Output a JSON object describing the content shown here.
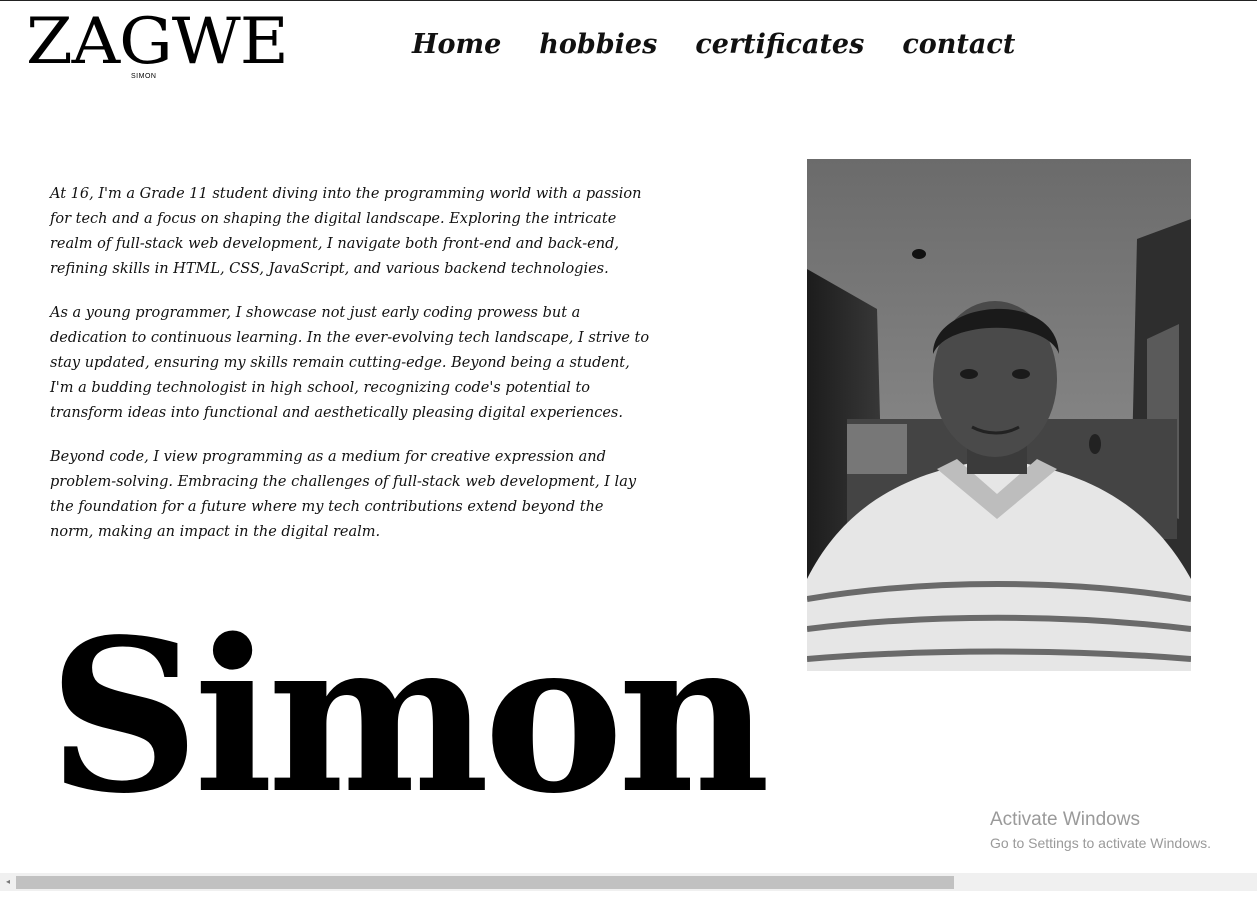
{
  "logo": {
    "text": "ZAGWE",
    "subtext": "SIMON"
  },
  "nav": {
    "items": [
      {
        "label": "Home"
      },
      {
        "label": "hobbies"
      },
      {
        "label": "certificates"
      },
      {
        "label": "contact"
      }
    ]
  },
  "bio": {
    "paragraphs": [
      "At 16, I'm a Grade 11 student diving into the programming world with a passion for tech and a focus on shaping the digital landscape. Exploring the intricate realm of full-stack web development, I navigate both front-end and back-end, refining skills in HTML, CSS, JavaScript, and various backend technologies.",
      "As a young programmer, I showcase not just early coding prowess but a dedication to continuous learning. In the ever-evolving tech landscape, I strive to stay updated, ensuring my skills remain cutting-edge. Beyond being a student, I'm a budding technologist in high school, recognizing code's potential to transform ideas into functional and aesthetically pleasing digital experiences.",
      "Beyond code, I view programming as a medium for creative expression and problem-solving. Embracing the challenges of full-stack web development, I lay the foundation for a future where my tech contributions extend beyond the norm, making an impact in the digital realm."
    ]
  },
  "hero": {
    "name": "Simon"
  },
  "photo": {
    "icon": "portrait-photo"
  },
  "watermark": {
    "title": "Activate Windows",
    "subtitle": "Go to Settings to activate Windows."
  },
  "scrollbar": {
    "left_arrow": "◂",
    "position": 0.0,
    "visible_fraction": 0.75
  },
  "colors": {
    "text": "#111111",
    "background": "#ffffff",
    "watermark": "#9a9a9a",
    "scroll_thumb": "#c1c1c1"
  }
}
